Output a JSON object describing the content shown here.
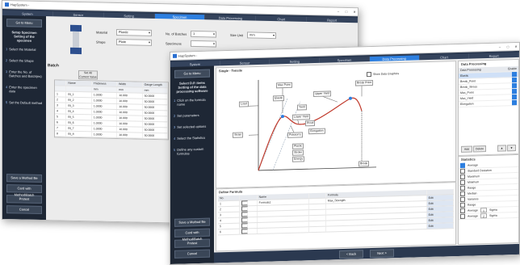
{
  "window_title": "HapSystem -",
  "window_controls": [
    "–",
    "□",
    "✕"
  ],
  "tabs": [
    "System",
    "Sensor",
    "Setting",
    "Specimen",
    "Data Processing",
    "Chart",
    "Report"
  ],
  "win1": {
    "active_tab": 3,
    "side_top_button": "Go to Menu",
    "side_heading": "Setup Specimen\nSetting of the specimen",
    "steps": [
      {
        "num": "1",
        "label": "Select the Material"
      },
      {
        "num": "2",
        "label": "Select the Shape"
      },
      {
        "num": "3",
        "label": "Enter the No. of Batches and Batch(es)"
      },
      {
        "num": "4",
        "label": "Enter the specimen data"
      },
      {
        "num": "5",
        "label": "Set the Default method"
      }
    ],
    "side_buttons": [
      "Save a Method file",
      "Card with Method/Batch",
      "Pretest",
      "Cancel"
    ],
    "fields": {
      "material_label": "Material",
      "material_value": "Plastic",
      "shape_label": "Shape",
      "shape_value": "Plate",
      "batches_label": "No. of Batches",
      "batches_value": "1",
      "specimens_label": "Specimens",
      "specimens_value": "",
      "size_unit_label": "Size Unit",
      "size_unit_value": "mm"
    },
    "section_title": "Batch",
    "copy_button": "Set All\nCurrent Value",
    "table_headers": [
      "",
      "Name",
      "Thickness",
      "Width",
      "Gauge Length"
    ],
    "table_units": [
      "",
      "",
      "mm",
      "mm",
      "mm"
    ],
    "table_rows": [
      [
        "1",
        "Bt_1",
        "1.0000",
        "10.000",
        "50.0000"
      ],
      [
        "2",
        "Bt_2",
        "1.0000",
        "10.000",
        "50.0000"
      ],
      [
        "3",
        "Bt_3",
        "1.0000",
        "10.000",
        "50.0000"
      ],
      [
        "4",
        "Bt_4",
        "1.0000",
        "10.000",
        "50.0000"
      ],
      [
        "5",
        "Bt_5",
        "1.0000",
        "10.000",
        "50.0000"
      ],
      [
        "6",
        "Bt_6",
        "1.0000",
        "10.000",
        "50.0000"
      ],
      [
        "7",
        "Bt_7",
        "1.0000",
        "10.000",
        "50.0000"
      ],
      [
        "8",
        "Bt_8",
        "1.0000",
        "10.000",
        "50.0000"
      ]
    ]
  },
  "win2": {
    "active_tab": 4,
    "side_top_button": "Go to Menu",
    "side_heading": "Select D.P. items\nSetting of the data processing software",
    "steps": [
      {
        "num": "1",
        "label": "Click on the formula name"
      },
      {
        "num": "2",
        "label": "Set parameters"
      },
      {
        "num": "3",
        "label": "Set selected options"
      },
      {
        "num": "4",
        "label": "Select the Statistics"
      },
      {
        "num": "5",
        "label": "Define any custom formulas"
      }
    ],
    "side_buttons": [
      "Save a Method file",
      "Card with Method/Batch",
      "Pretest",
      "Cancel"
    ],
    "chart_panel_title": "Single - Tensile",
    "show_option_label": "Show Data Graphics",
    "callouts": {
      "load": "Load",
      "max_point": "Max Point",
      "break_point": "Break Point",
      "upper_yield": "Upper Yield",
      "lower_yield": "Lower Yield",
      "elastic": "Elastic",
      "yield": "Yield",
      "proof": "Proof",
      "elongation": "Elongation",
      "poissons": "Poisson's",
      "strain": "Strain",
      "plastic": "Plastic",
      "stroke": "Stroke",
      "energy": "Energy",
      "break": "Break"
    },
    "dp_title": "Data Processing",
    "dp_headers": [
      "Data Processing",
      "Enable"
    ],
    "dp_items": [
      {
        "label": "Elastic",
        "on": true
      },
      {
        "label": "Break_Point",
        "on": true
      },
      {
        "label": "Break_Stress",
        "on": true
      },
      {
        "label": "Max_Point",
        "on": true
      },
      {
        "label": "Max_Yield",
        "on": true
      },
      {
        "label": "Elongation",
        "on": true
      }
    ],
    "dp_buttons": [
      "Add",
      "Delete",
      "▲",
      "▼"
    ],
    "stats_title": "Statistics",
    "stats_items": [
      {
        "label": "Average",
        "on": true
      },
      {
        "label": "Standard Deviation",
        "on": false
      },
      {
        "label": "Maximum",
        "on": false
      },
      {
        "label": "Minimum",
        "on": false
      },
      {
        "label": "Range",
        "on": false
      },
      {
        "label": "Median",
        "on": false
      },
      {
        "label": "Variance",
        "on": false
      },
      {
        "label": "Range",
        "on": false
      }
    ],
    "stats_extra": [
      {
        "label": "Average",
        "mid": "1",
        "right": "Sigma"
      },
      {
        "label": "Average",
        "mid": "2",
        "right": "Sigma"
      }
    ],
    "formula_title": "Define Formula",
    "formula_headers": [
      "No.",
      "",
      "Name",
      "",
      "Formula",
      ""
    ],
    "formula_rows": [
      {
        "no": "1",
        "name": "Formula1",
        "formula": "Max_Strength",
        "action": "Edit"
      },
      {
        "no": "2",
        "name": "",
        "formula": "",
        "action": "Edit"
      },
      {
        "no": "3",
        "name": "",
        "formula": "",
        "action": "Edit"
      },
      {
        "no": "4",
        "name": "",
        "formula": "",
        "action": "Edit"
      },
      {
        "no": "5",
        "name": "",
        "formula": "",
        "action": "Edit"
      },
      {
        "no": "6",
        "name": "",
        "formula": "",
        "action": "Edit"
      }
    ],
    "back_button": "< Back",
    "next_button": "Next >"
  }
}
